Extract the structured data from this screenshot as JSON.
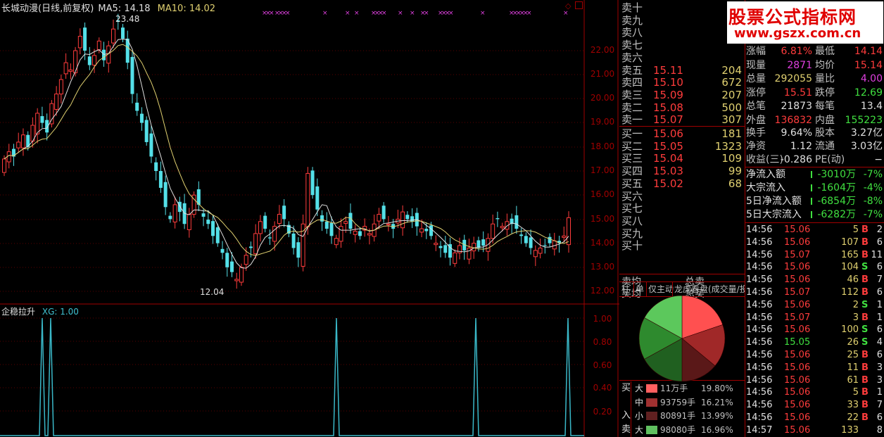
{
  "header": {
    "title": "长城动漫(日线,前复权)",
    "ma5": "MA5: 14.18",
    "ma10": "MA10: 14.02",
    "high_mark": "23.48",
    "low_mark": "12.04"
  },
  "sub_header": {
    "title": "企稳拉升",
    "xg": "XG: 1.00"
  },
  "price_axis": [
    "22.00",
    "21.00",
    "20.00",
    "19.00",
    "18.00",
    "17.00",
    "16.00",
    "15.00",
    "14.00",
    "13.00",
    "12.00"
  ],
  "sub_axis": [
    "1.00",
    "0.80",
    "0.60",
    "0.40",
    "0.20"
  ],
  "watermark": {
    "line1": "股票公式指标网",
    "line2": "www.gszx.com.cn"
  },
  "orderbook": {
    "asks": [
      {
        "label": "卖十",
        "price": "",
        "vol": ""
      },
      {
        "label": "卖九",
        "price": "",
        "vol": ""
      },
      {
        "label": "卖八",
        "price": "",
        "vol": ""
      },
      {
        "label": "卖七",
        "price": "",
        "vol": ""
      },
      {
        "label": "卖六",
        "price": "",
        "vol": ""
      },
      {
        "label": "卖五",
        "price": "15.11",
        "vol": "204"
      },
      {
        "label": "卖四",
        "price": "15.10",
        "vol": "672"
      },
      {
        "label": "卖三",
        "price": "15.09",
        "vol": "207"
      },
      {
        "label": "卖二",
        "price": "15.08",
        "vol": "500"
      },
      {
        "label": "卖一",
        "price": "15.07",
        "vol": "307"
      }
    ],
    "bids": [
      {
        "label": "买一",
        "price": "15.06",
        "vol": "181"
      },
      {
        "label": "买二",
        "price": "15.05",
        "vol": "1323"
      },
      {
        "label": "买三",
        "price": "15.04",
        "vol": "109"
      },
      {
        "label": "买四",
        "price": "15.03",
        "vol": "99"
      },
      {
        "label": "买五",
        "price": "15.02",
        "vol": "68"
      },
      {
        "label": "买六",
        "price": "",
        "vol": ""
      },
      {
        "label": "买七",
        "price": "",
        "vol": ""
      },
      {
        "label": "买八",
        "price": "",
        "vol": ""
      },
      {
        "label": "买九",
        "price": "",
        "vol": ""
      },
      {
        "label": "买十",
        "price": "",
        "vol": ""
      }
    ],
    "sell_avg_label": "卖均",
    "sell_total_label": "总卖",
    "buy_avg_label": "买均",
    "buy_total_label": "总买"
  },
  "tabs": [
    "柱",
    "单",
    "仅主动",
    "龙虎看盘(成交量/投"
  ],
  "quote": {
    "rows": [
      {
        "l1": "涨幅",
        "v1": "6.81%",
        "c1": "#ff3c3c",
        "l2": "最低",
        "v2": "14.14",
        "c2": "#ff3c3c"
      },
      {
        "l1": "现量",
        "v1": "2871",
        "c1": "#e040e0",
        "l2": "均价",
        "v2": "15.14",
        "c2": "#ff3c3c"
      },
      {
        "l1": "总量",
        "v1": "292055",
        "c1": "#e0d070",
        "l2": "量比",
        "v2": "4.00",
        "c2": "#e040e0"
      },
      {
        "l1": "涨停",
        "v1": "15.51",
        "c1": "#ff3c3c",
        "l2": "跌停",
        "v2": "12.69",
        "c2": "#40e040"
      },
      {
        "l1": "总笔",
        "v1": "21873",
        "c1": "#e0e0e0",
        "l2": "每笔",
        "v2": "13.4",
        "c2": "#e0e0e0"
      },
      {
        "l1": "外盘",
        "v1": "136832",
        "c1": "#ff3c3c",
        "l2": "内盘",
        "v2": "155223",
        "c2": "#40e040"
      },
      {
        "l1": "换手",
        "v1": "9.64%",
        "c1": "#e0e0e0",
        "l2": "股本",
        "v2": "3.27亿",
        "c2": "#e0e0e0"
      },
      {
        "l1": "净资",
        "v1": "1.12",
        "c1": "#e0e0e0",
        "l2": "流通",
        "v2": "3.03亿",
        "c2": "#e0e0e0"
      },
      {
        "l1": "收益(三)",
        "v1": "-0.286",
        "c1": "#e0e0e0",
        "l2": "PE(动)",
        "v2": "−",
        "c2": "#e0e0e0"
      }
    ],
    "flows": [
      {
        "label": "净流入额",
        "value": "-3010万",
        "pct": "-7%"
      },
      {
        "label": "大宗流入",
        "value": "-1604万",
        "pct": "-4%"
      },
      {
        "label": "5日净流入额",
        "value": "-6854万",
        "pct": "-8%"
      },
      {
        "label": "5日大宗流入",
        "value": "-6282万",
        "pct": "-7%"
      }
    ]
  },
  "ticks": [
    {
      "t": "14:56",
      "p": "15.06",
      "v": "5",
      "s": "B",
      "n": "2"
    },
    {
      "t": "14:56",
      "p": "15.06",
      "v": "107",
      "s": "B",
      "n": "6"
    },
    {
      "t": "14:56",
      "p": "15.07",
      "v": "165",
      "s": "B",
      "n": "11"
    },
    {
      "t": "14:56",
      "p": "15.06",
      "v": "104",
      "s": "S",
      "n": "6"
    },
    {
      "t": "14:56",
      "p": "15.06",
      "v": "46",
      "s": "B",
      "n": "7"
    },
    {
      "t": "14:56",
      "p": "15.07",
      "v": "112",
      "s": "B",
      "n": "6"
    },
    {
      "t": "14:56",
      "p": "15.06",
      "v": "2",
      "s": "S",
      "n": "1"
    },
    {
      "t": "14:56",
      "p": "15.07",
      "v": "3",
      "s": "B",
      "n": "1"
    },
    {
      "t": "14:56",
      "p": "15.06",
      "v": "100",
      "s": "S",
      "n": "6"
    },
    {
      "t": "14:56",
      "p": "15.05",
      "v": "26",
      "s": "S",
      "n": "4"
    },
    {
      "t": "14:56",
      "p": "15.06",
      "v": "25",
      "s": "B",
      "n": "6"
    },
    {
      "t": "14:56",
      "p": "15.06",
      "v": "11",
      "s": "B",
      "n": "3"
    },
    {
      "t": "14:56",
      "p": "15.06",
      "v": "61",
      "s": "B",
      "n": "3"
    },
    {
      "t": "14:56",
      "p": "15.06",
      "v": "5",
      "s": "B",
      "n": "1"
    },
    {
      "t": "14:56",
      "p": "15.06",
      "v": "33",
      "s": "B",
      "n": "7"
    },
    {
      "t": "14:56",
      "p": "15.06",
      "v": "22",
      "s": "B",
      "n": "6"
    },
    {
      "t": "14:57",
      "p": "15.06",
      "v": "133",
      "s": "",
      "n": "8"
    }
  ],
  "distribution": {
    "rows": [
      {
        "side": "买",
        "size": "大",
        "val": "11万手",
        "pct": "19.80%",
        "color": "#ff6060"
      },
      {
        "side": "",
        "size": "中",
        "val": "93759手",
        "pct": "16.21%",
        "color": "#a03030"
      },
      {
        "side": "入",
        "size": "小",
        "val": "80891手",
        "pct": "13.99%",
        "color": "#602020"
      },
      {
        "side": "卖",
        "size": "大",
        "val": "98080手",
        "pct": "16.96%",
        "color": "#60c060"
      }
    ],
    "slices": [
      {
        "label": "买大",
        "pct": 19.8,
        "color": "#ff5050"
      },
      {
        "label": "买中",
        "pct": 16.21,
        "color": "#a02828"
      },
      {
        "label": "买小",
        "pct": 13.99,
        "color": "#5a1818"
      },
      {
        "label": "卖小",
        "pct": 17.0,
        "color": "#206020"
      },
      {
        "label": "卖中",
        "pct": 16.04,
        "color": "#2e8a2e"
      },
      {
        "label": "卖大",
        "pct": 16.96,
        "color": "#5cc85c"
      }
    ]
  }
}
